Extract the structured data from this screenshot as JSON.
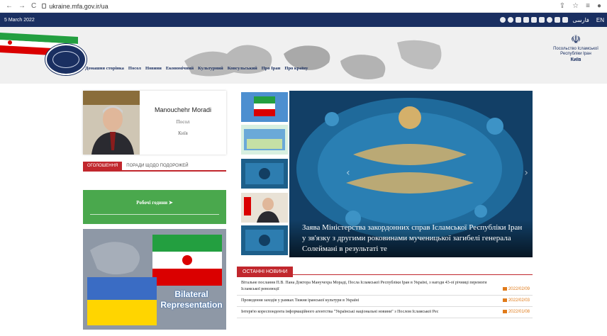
{
  "browser": {
    "url": "ukraine.mfa.gov.ir/ua",
    "nav_back": "←",
    "nav_forward": "→",
    "nav_reload": "C"
  },
  "topbar": {
    "date": "5 March 2022",
    "lang_fa": "فارسی",
    "lang_en": "EN"
  },
  "header": {
    "nav": [
      "Домашня сторінка",
      "Посол",
      "Новини",
      "Економічний",
      "Культурний",
      "Консульський",
      "Про Іран",
      "Про країну"
    ],
    "embassy_line1": "Посольство Ісламської",
    "embassy_line2": "Республіки Іран",
    "embassy_city": "Київ"
  },
  "ambassador": {
    "name": "Manouchehr Moradi",
    "role": "Посол",
    "city": "Київ"
  },
  "tabs": {
    "announcements": "ОГОЛОШЕННЯ",
    "travel_advice": "ПОРАДИ ЩОДО ПОДОРОЖЕЙ"
  },
  "hours": {
    "label": "Робочі години"
  },
  "bilateral": {
    "line1": "Bilateral",
    "line2": "Representation"
  },
  "slider": {
    "caption": "Заява Міністерства закордонних справ Ісламської Республіки Іран у зв'язку з другими роковинами мученицької загибелі генерала Солеймані в результаті те"
  },
  "news": {
    "title": "ОСТАННІ НОВИНИ",
    "items": [
      {
        "text": "Вітальне послання П.В. Пана Доктора Манучехра Мораді, Посла Ісламської Республіки Іран в Україні, з нагоди 43-ої річниці перемоги Ісламської революції",
        "date": "2022/02/09"
      },
      {
        "text": "Проведення заходів у рамках Тижня іранської культури в Україні",
        "date": "2022/02/03"
      },
      {
        "text": "Інтерв'ю кореспондента інформаційного агентства \"Українські національні новини\" з Послом Ісламської Рес",
        "date": "2022/01/08"
      }
    ]
  },
  "colors": {
    "navy": "#1a2f61",
    "red": "#c1272d",
    "green": "#4aa84d",
    "orange": "#e07b1a"
  }
}
